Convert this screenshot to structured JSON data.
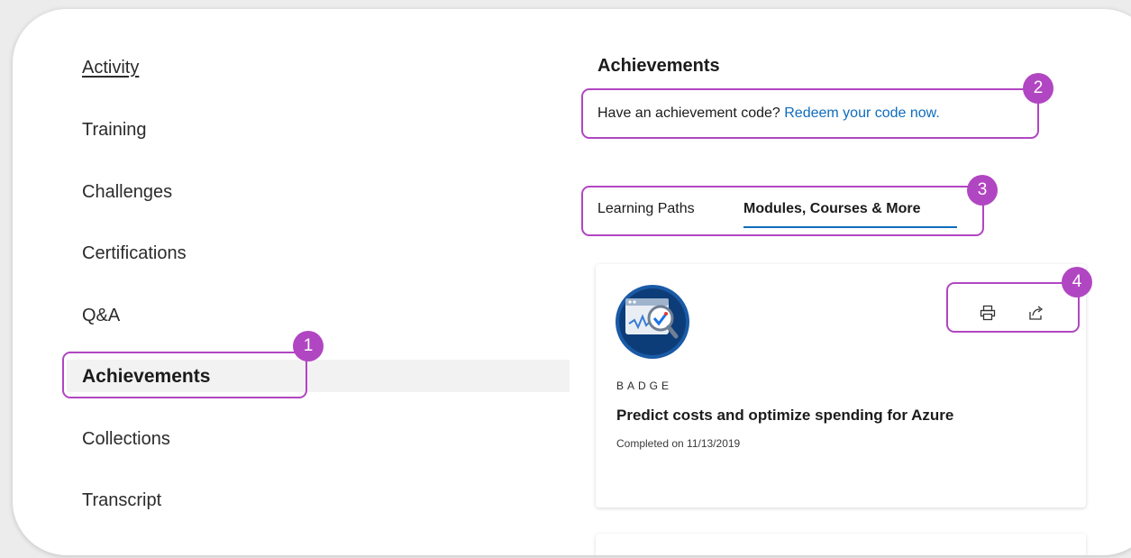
{
  "sidebar": {
    "items": [
      {
        "label": "Activity"
      },
      {
        "label": "Training"
      },
      {
        "label": "Challenges"
      },
      {
        "label": "Certifications"
      },
      {
        "label": "Q&A"
      },
      {
        "label": "Achievements"
      },
      {
        "label": "Collections"
      },
      {
        "label": "Transcript"
      }
    ],
    "active": "Achievements"
  },
  "main": {
    "title": "Achievements",
    "redeem_prompt": "Have an achievement code?",
    "redeem_link": "Redeem your code now.",
    "tabs": [
      {
        "label": "Learning Paths"
      },
      {
        "label": "Modules, Courses & More"
      }
    ],
    "active_tab": "Modules, Courses & More",
    "card": {
      "type": "BADGE",
      "title": "Predict costs and optimize spending for Azure",
      "completed": "Completed on 11/13/2019",
      "actions": [
        "print-icon",
        "share-icon"
      ]
    }
  },
  "callouts": [
    "1",
    "2",
    "3",
    "4"
  ],
  "colors": {
    "accent": "#0f6cbd",
    "callout": "#b146c2",
    "active_bg": "#f2f2f2"
  }
}
